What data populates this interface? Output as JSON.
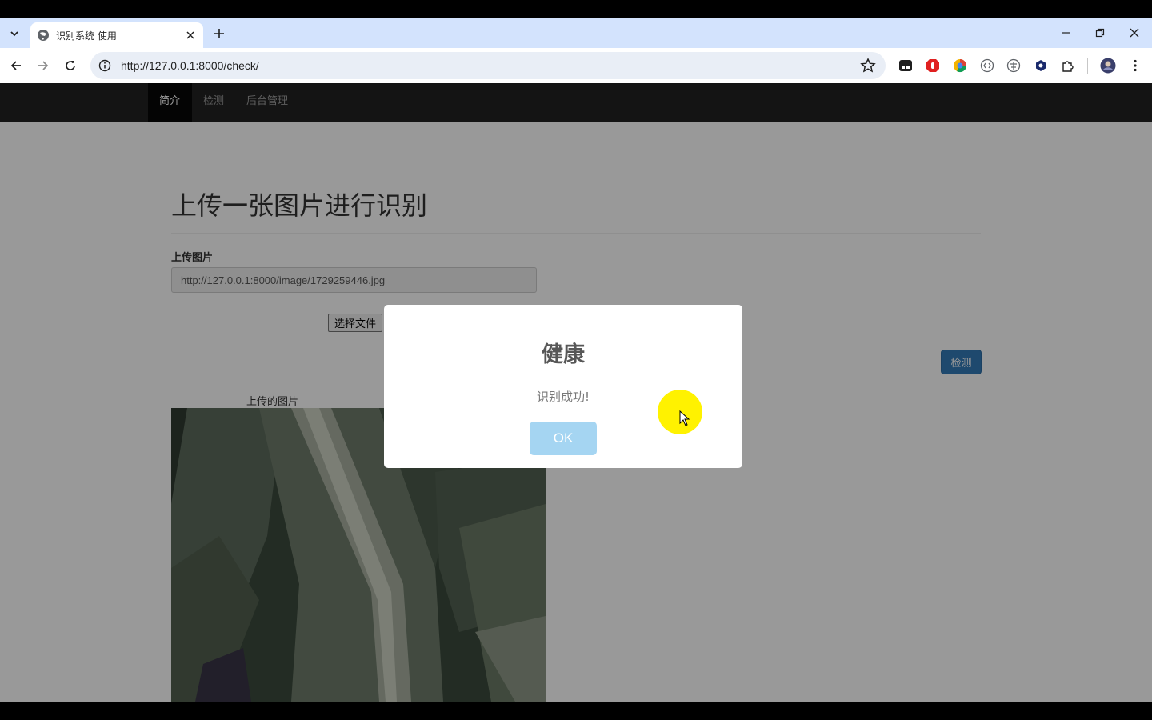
{
  "browser": {
    "tab_title": "识别系统 使用",
    "url": "http://127.0.0.1:8000/check/"
  },
  "nav": {
    "items": [
      {
        "label": "简介",
        "active": true
      },
      {
        "label": "检测",
        "active": false
      },
      {
        "label": "后台管理",
        "active": false
      }
    ]
  },
  "main": {
    "heading": "上传一张图片进行识别",
    "upload_label": "上传图片",
    "image_url_value": "http://127.0.0.1:8000/image/1729259446.jpg",
    "choose_file_label": "选择文件",
    "detect_label": "检测",
    "preview_caption": "上传的图片"
  },
  "modal": {
    "title": "健康",
    "text": "识别成功!",
    "ok_label": "OK"
  },
  "colors": {
    "navbar": "#222222",
    "primary": "#337ab7",
    "ok_button": "#a5d5f2",
    "cursor_highlight": "#fff200"
  }
}
